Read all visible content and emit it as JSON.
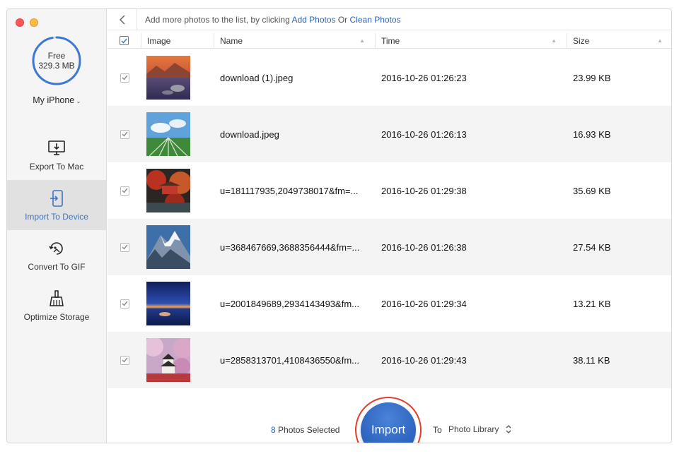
{
  "window": {
    "controls": [
      "close",
      "minimize"
    ]
  },
  "sidebar": {
    "storage": {
      "label": "Free",
      "value": "329.3 MB",
      "ring_color": "#3d78d1",
      "used_fraction": 0.97
    },
    "device": {
      "name": "My iPhone",
      "icon": "chevron-down-icon"
    },
    "items": [
      {
        "label": "Export To Mac",
        "icon": "monitor-download-icon",
        "active": false
      },
      {
        "label": "Import To Device",
        "icon": "phone-import-icon",
        "active": true
      },
      {
        "label": "Convert To GIF",
        "icon": "gif-convert-icon",
        "active": false
      },
      {
        "label": "Optimize Storage",
        "icon": "broom-icon",
        "active": false
      }
    ]
  },
  "topbar": {
    "hint_prefix": "Add more photos to the list, by clicking ",
    "add_photos_link": "Add Photos",
    "hint_or": " Or ",
    "clean_photos_link": "Clean Photos"
  },
  "table": {
    "columns": [
      "Image",
      "Name",
      "Time",
      "Size"
    ],
    "rows": [
      {
        "name": "download (1).jpeg",
        "time": "2016-10-26 01:26:23",
        "size": "23.99 KB",
        "thumb": "lake-sunset"
      },
      {
        "name": "download.jpeg",
        "time": "2016-10-26 01:26:13",
        "size": "16.93 KB",
        "thumb": "sky-field"
      },
      {
        "name": "u=181117935,2049738017&fm=...",
        "time": "2016-10-26 01:29:38",
        "size": "35.69 KB",
        "thumb": "red-pavilion"
      },
      {
        "name": "u=368467669,3688356444&fm=...",
        "time": "2016-10-26 01:26:38",
        "size": "27.54 KB",
        "thumb": "snow-mountain"
      },
      {
        "name": "u=2001849689,2934143493&fm...",
        "time": "2016-10-26 01:29:34",
        "size": "13.21 KB",
        "thumb": "blue-dusk-lake"
      },
      {
        "name": "u=2858313701,4108436550&fm...",
        "time": "2016-10-26 01:29:43",
        "size": "38.11 KB",
        "thumb": "castle-blossom"
      }
    ]
  },
  "footer": {
    "selected_count": "8",
    "selected_label": " Photos Selected",
    "import_label": "Import",
    "to_label": "To",
    "destination": "Photo Library"
  },
  "colors": {
    "accent": "#2d62b9",
    "highlight_ring": "#e63b2a"
  }
}
